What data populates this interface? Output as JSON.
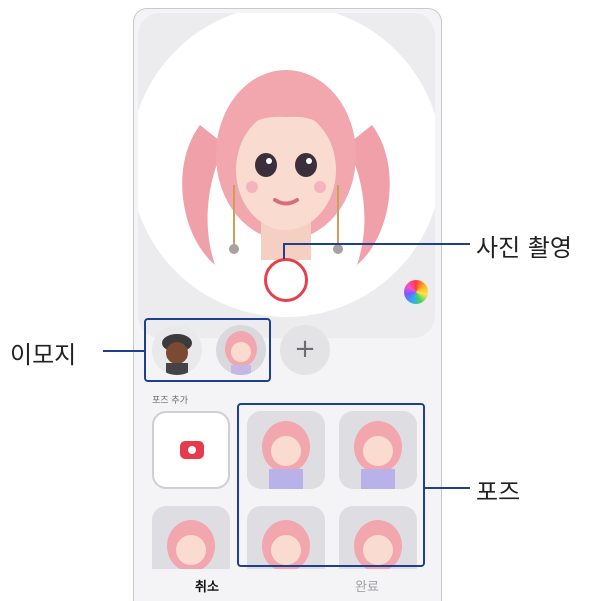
{
  "callouts": {
    "capture": "사진 촬영",
    "emoji": "이모지",
    "pose": "포즈"
  },
  "section_label": "포즈 추가",
  "add_button": "+",
  "bottom": {
    "cancel": "취소",
    "done": "완료"
  },
  "colors": {
    "shutter_ring": "#e2434b",
    "camera_icon": "#e83a4d",
    "callout_line": "#1f3f8f",
    "avatar_hair": "#f2a6ad"
  },
  "icons": [
    "color-palette-icon",
    "plus-icon",
    "camera-icon"
  ]
}
